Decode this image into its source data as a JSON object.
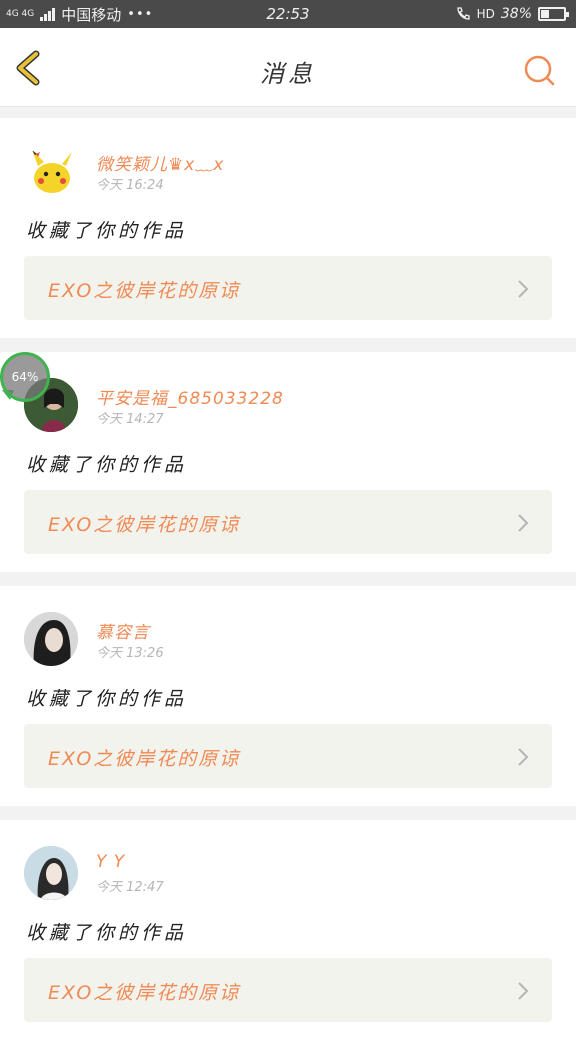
{
  "status_bar": {
    "network_type": "4G 4G",
    "carrier": "中国移动",
    "more": "•••",
    "time": "22:53",
    "hd": "HD",
    "battery_percent": "38%",
    "battery_level": 0.38
  },
  "nav": {
    "title": "消息",
    "back_icon": "back-arrow-icon",
    "search_icon": "search-icon",
    "accent_color": "#f08a55",
    "back_color": "#e8c13a"
  },
  "messages": [
    {
      "username": "微笑颖儿♛x﹏x",
      "time": "今天 16:24",
      "action": "收藏了你的作品",
      "work_title": "EXO之彼岸花的原谅"
    },
    {
      "username": "平安是福_685033228",
      "time": "今天 14:27",
      "action": "收藏了你的作品",
      "work_title": "EXO之彼岸花的原谅"
    },
    {
      "username": "慕容言",
      "time": "今天 13:26",
      "action": "收藏了你的作品",
      "work_title": "EXO之彼岸花的原谅"
    },
    {
      "username": "Y Y",
      "time": "今天 12:47",
      "action": "收藏了你的作品",
      "work_title": "EXO之彼岸花的原谅"
    }
  ],
  "overlay": {
    "progress_text": "64%"
  }
}
